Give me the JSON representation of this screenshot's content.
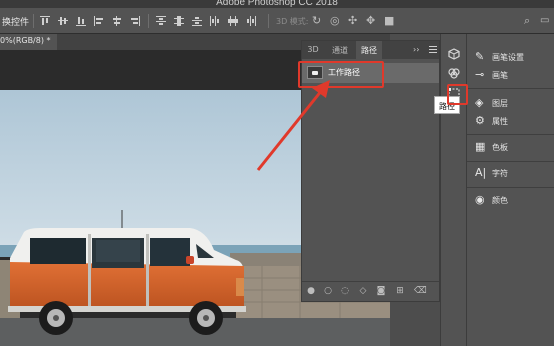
{
  "window": {
    "title": "Adobe Photoshop CC 2018"
  },
  "options_bar": {
    "label": "换控件",
    "mode_3d_label": "3D 模式:"
  },
  "document": {
    "tab_label": "0%(RGB/8) *"
  },
  "paths_panel": {
    "tabs": [
      {
        "label": "3D",
        "active": false
      },
      {
        "label": "通道",
        "active": false
      },
      {
        "label": "路径",
        "active": true
      }
    ],
    "collapse_glyph": "››",
    "paths": [
      {
        "name": "工作路径",
        "selected": true
      }
    ],
    "footer_icons": [
      "fill-path-icon",
      "stroke-path-icon",
      "load-selection-icon",
      "make-work-path-icon",
      "add-mask-icon",
      "new-path-icon",
      "delete-path-icon"
    ]
  },
  "tooltip": {
    "text": "路径"
  },
  "right_dock": {
    "items": [
      {
        "label": "画笔设置",
        "icon": "brush-settings-icon"
      },
      {
        "label": "画笔",
        "icon": "brush-icon"
      },
      {
        "label": "图层",
        "icon": "layers-icon"
      },
      {
        "label": "属性",
        "icon": "properties-icon"
      },
      {
        "label": "色板",
        "icon": "swatches-icon"
      },
      {
        "label": "字符",
        "icon": "character-icon"
      },
      {
        "label": "颜色",
        "icon": "color-icon"
      }
    ]
  },
  "colors": {
    "accent_red": "#e0392b",
    "van_orange": "#d4622a",
    "panel_bg": "#535353"
  }
}
